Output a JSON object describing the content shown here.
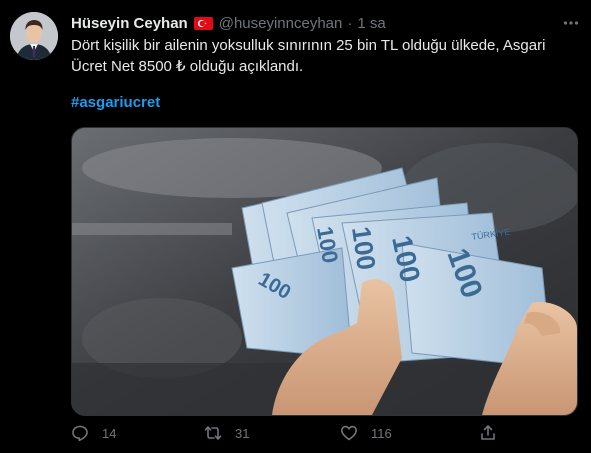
{
  "tweet": {
    "display_name": "Hüseyin Ceyhan",
    "flag_icon": "turkey-flag-icon",
    "handle": "@huseyinnceyhan",
    "separator": "·",
    "time": "1 sa",
    "text_line1": "Dört kişilik bir ailenin yoksulluk sınırının 25 bin TL olduğu ülkede, Asgari",
    "text_line2": "Ücret Net 8500 ₺ olduğu açıklandı.",
    "hashtag": "#asgariucret",
    "media_alt": "Hands counting Turkish 100 lira banknotes",
    "banknote_value": "100",
    "banknote_country": "TÜRKİYE"
  },
  "actions": {
    "reply_count": "14",
    "retweet_count": "31",
    "like_count": "116"
  },
  "colors": {
    "background": "#000000",
    "text": "#e7e9ea",
    "secondary": "#71767b",
    "link": "#1d9bf0",
    "banknote": "#a8c6e0"
  }
}
